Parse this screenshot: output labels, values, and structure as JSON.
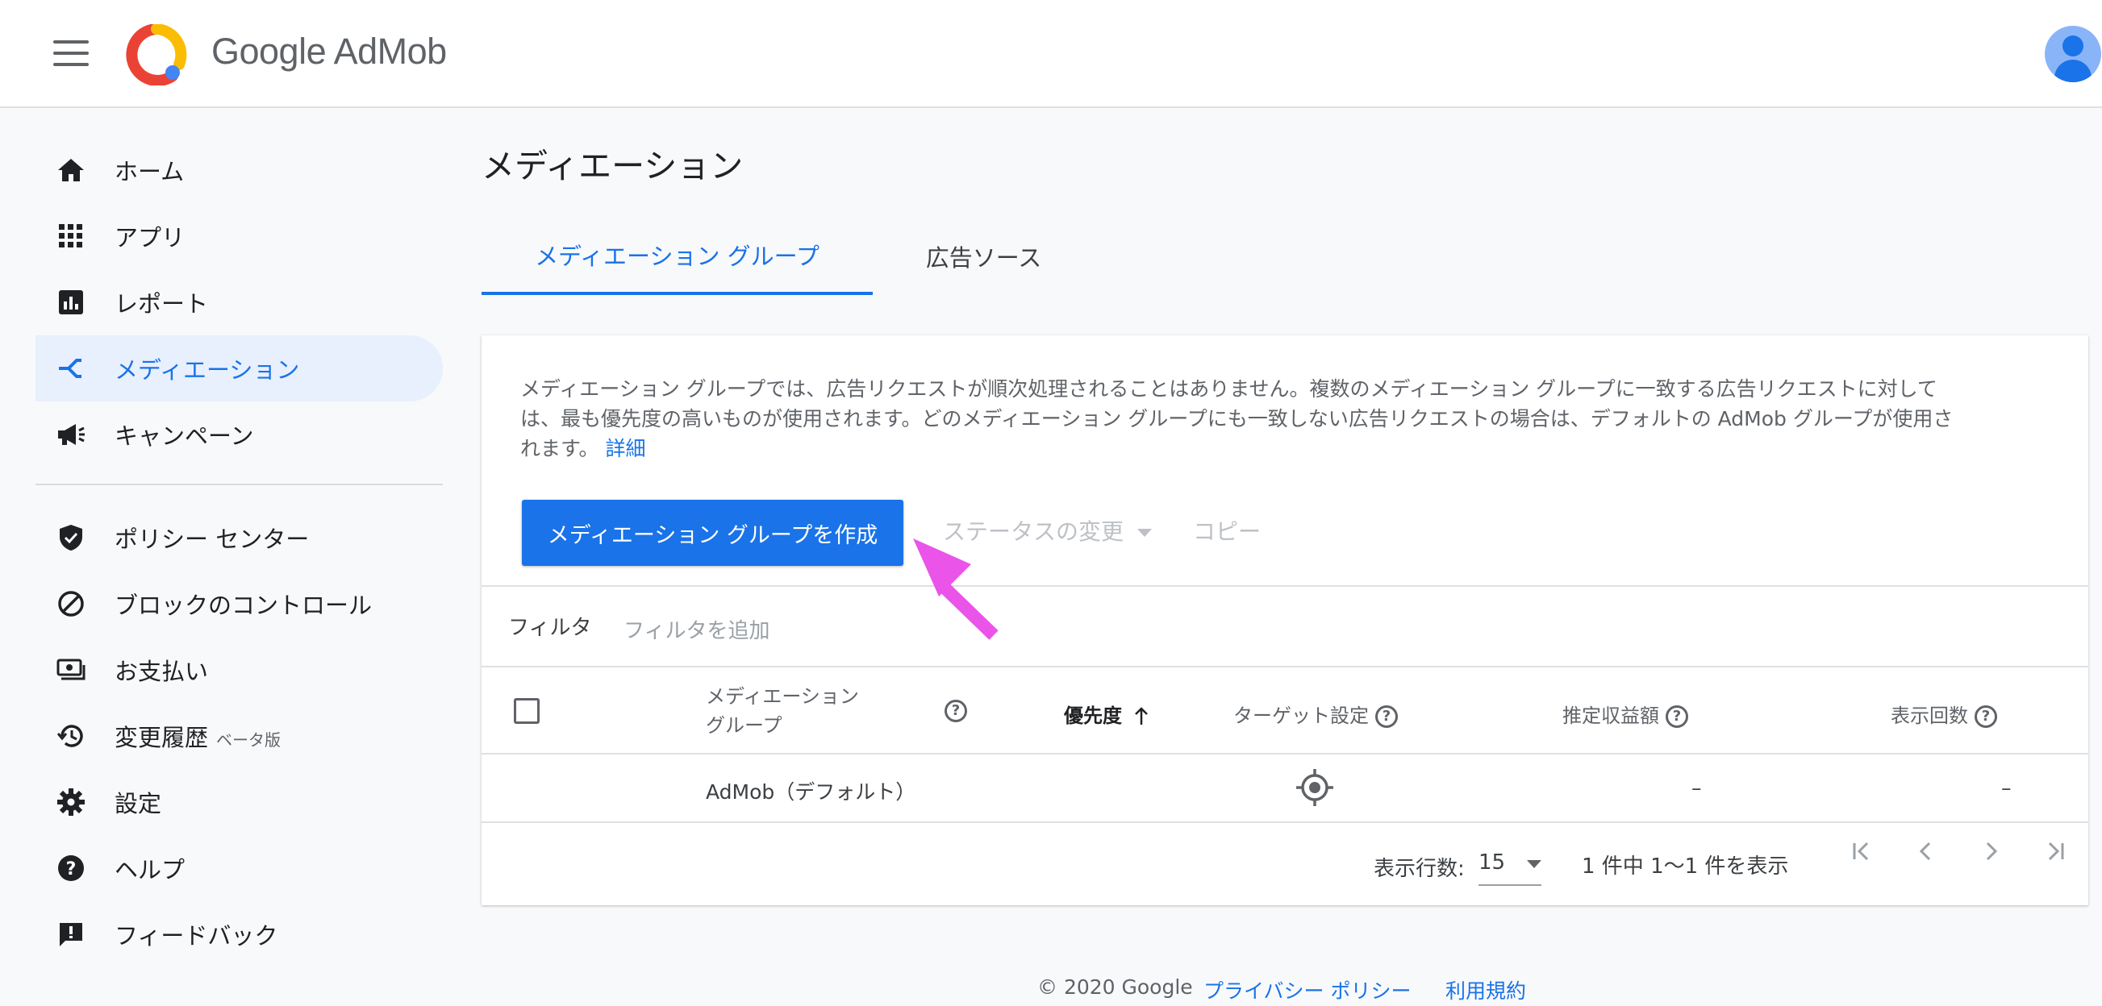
{
  "header": {
    "brand": "Google AdMob",
    "icons": {
      "menu": "hamburger-icon",
      "logo": "admob-logo",
      "avatar": "user-avatar"
    }
  },
  "sidebar": {
    "items": [
      {
        "label": "ホーム",
        "icon": "home-icon",
        "active": false
      },
      {
        "label": "アプリ",
        "icon": "apps-grid-icon",
        "active": false
      },
      {
        "label": "レポート",
        "icon": "report-chart-icon",
        "active": false
      },
      {
        "label": "メディエーション",
        "icon": "mediation-icon",
        "active": true
      },
      {
        "label": "キャンペーン",
        "icon": "megaphone-icon",
        "active": false
      }
    ],
    "items2": [
      {
        "label": "ポリシー センター",
        "icon": "shield-icon"
      },
      {
        "label": "ブロックのコントロール",
        "icon": "block-icon"
      },
      {
        "label": "お支払い",
        "icon": "payments-icon"
      },
      {
        "label": "変更履歴",
        "badge": "ベータ版",
        "icon": "history-icon"
      },
      {
        "label": "設定",
        "icon": "gear-icon"
      },
      {
        "label": "ヘルプ",
        "icon": "help-icon"
      },
      {
        "label": "フィードバック",
        "icon": "feedback-icon"
      }
    ]
  },
  "main": {
    "title": "メディエーション",
    "tabs": [
      {
        "label": "メディエーション グループ",
        "active": true
      },
      {
        "label": "広告ソース",
        "active": false
      }
    ],
    "description_line1": "メディエーション グループでは、広告リクエストが順次処理されることはありません。複数のメディエーション グループに一致する広告リクエストに対して",
    "description_line2": "は、最も優先度の高いものが使用されます。どのメディエーション グループにも一致しない広告リクエストの場合は、デフォルトの AdMob グループが使用さ",
    "description_line3": "れます。",
    "details_link": "詳細",
    "create_button": "メディエーション グループを作成",
    "status_button": "ステータスの変更",
    "copy_button": "コピー",
    "filter_label": "フィルタ",
    "filter_placeholder": "フィルタを追加",
    "columns": {
      "name_line1": "メディエーション",
      "name_line2": "グループ",
      "priority": "優先度",
      "targeting": "ターゲット設定",
      "revenue": "推定収益額",
      "impressions": "表示回数"
    },
    "rows": [
      {
        "name": "AdMob（デフォルト）",
        "targeting_icon": "target-icon",
        "revenue": "–",
        "impressions": "–"
      }
    ],
    "pagination": {
      "rows_label": "表示行数:",
      "rows_value": "15",
      "range": "1 件中 1〜1 件を表示"
    }
  },
  "footer": {
    "copyright": "© 2020 Google",
    "privacy": "プライバシー ポリシー",
    "terms": "利用規約"
  },
  "annotation": {
    "arrow_color": "#ea54e8"
  },
  "colors": {
    "accent": "#1a73e8",
    "active_bg": "#e8f0fe"
  }
}
